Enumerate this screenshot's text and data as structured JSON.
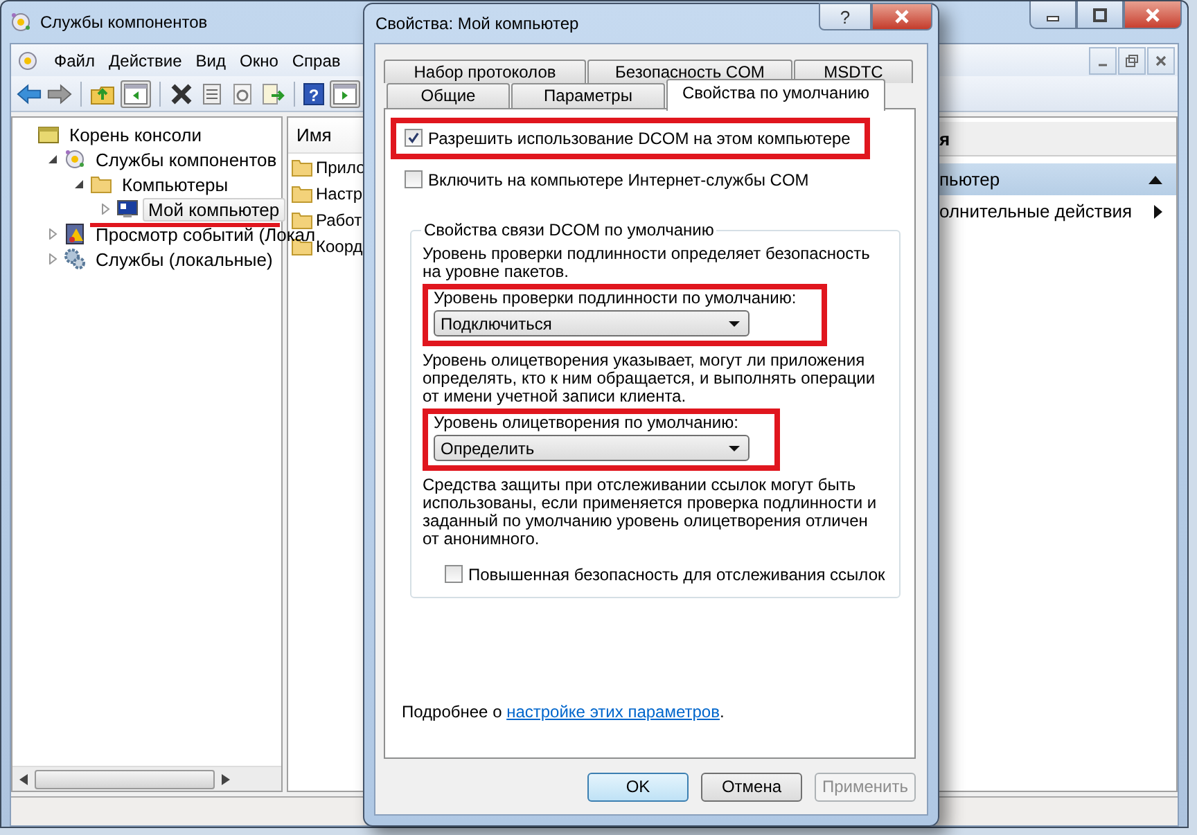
{
  "window": {
    "title": "Службы компонентов"
  },
  "menu": [
    "Файл",
    "Действие",
    "Вид",
    "Окно",
    "Справ"
  ],
  "toolbar": {
    "help": "?"
  },
  "tree": {
    "root": {
      "label": "Корень консоли"
    },
    "items": [
      {
        "label": "Службы компонентов",
        "kind": "components",
        "expanded": true,
        "selected": false,
        "children": [
          {
            "label": "Компьютеры",
            "kind": "folder",
            "expanded": true,
            "selected": false,
            "children": [
              {
                "label": "Мой компьютер",
                "kind": "computer",
                "expanded": false,
                "selected": true,
                "underlined": true
              }
            ]
          }
        ]
      },
      {
        "label": "Просмотр событий (Локал",
        "kind": "events",
        "expanded": false,
        "selected": false
      },
      {
        "label": "Службы (локальные)",
        "kind": "services",
        "expanded": false,
        "selected": false
      }
    ]
  },
  "list": {
    "columns": [
      "Имя"
    ],
    "rows": [
      "Прило",
      "Настр",
      "Работ",
      "Коорд"
    ]
  },
  "actions": {
    "header": "я",
    "items": [
      {
        "label": "пьютер",
        "kind": "section"
      },
      {
        "label": "олнительные действия",
        "kind": "submenu"
      }
    ]
  },
  "dialog": {
    "title": "Свойства: Мой компьютер",
    "help": "?",
    "tab_rows": [
      [
        {
          "label": "Набор протоколов",
          "selected": false
        },
        {
          "label": "Безопасность COM",
          "selected": false
        },
        {
          "label": "MSDTC",
          "selected": false
        }
      ],
      [
        {
          "label": "Общие",
          "selected": false
        },
        {
          "label": "Параметры",
          "selected": false
        },
        {
          "label": "Свойства по умолчанию",
          "selected": true
        }
      ]
    ],
    "options": [
      {
        "label": "Разрешить использование DCOM на этом компьютере",
        "checked": true,
        "highlighted": true
      },
      {
        "label": "Включить на компьютере Интернет-службы COM",
        "checked": false,
        "highlighted": false
      }
    ],
    "group": {
      "legend": "Свойства связи DCOM по умолчанию",
      "items": [
        {
          "kind": "text",
          "text": "Уровень проверки подлинности определяет безопасность на уровне пакетов."
        },
        {
          "kind": "select",
          "label": "Уровень проверки подлинности по умолчанию:",
          "value": "Подключиться",
          "highlighted": true
        },
        {
          "kind": "text",
          "text": "Уровень олицетворения указывает, могут ли приложения определять, кто к ним обращается, и выполнять операции от имени учетной записи клиента."
        },
        {
          "kind": "select",
          "label": "Уровень олицетворения по умолчанию:",
          "value": "Определить",
          "highlighted": true
        },
        {
          "kind": "text",
          "text": "Средства защиты при отслеживании ссылок могут быть использованы, если применяется проверка подлинности и заданный по умолчанию уровень олицетворения отличен от анонимного."
        },
        {
          "kind": "checkbox",
          "label": "Повышенная безопасность для отслеживания ссылок",
          "checked": false
        }
      ]
    },
    "more": {
      "text": "Подробнее о ",
      "link": "настройке этих параметров",
      "after": "."
    },
    "buttons": [
      {
        "label": "OK",
        "default": true,
        "disabled": false
      },
      {
        "label": "Отмена",
        "default": false,
        "disabled": false
      },
      {
        "label": "Применить",
        "default": false,
        "disabled": true
      }
    ]
  }
}
